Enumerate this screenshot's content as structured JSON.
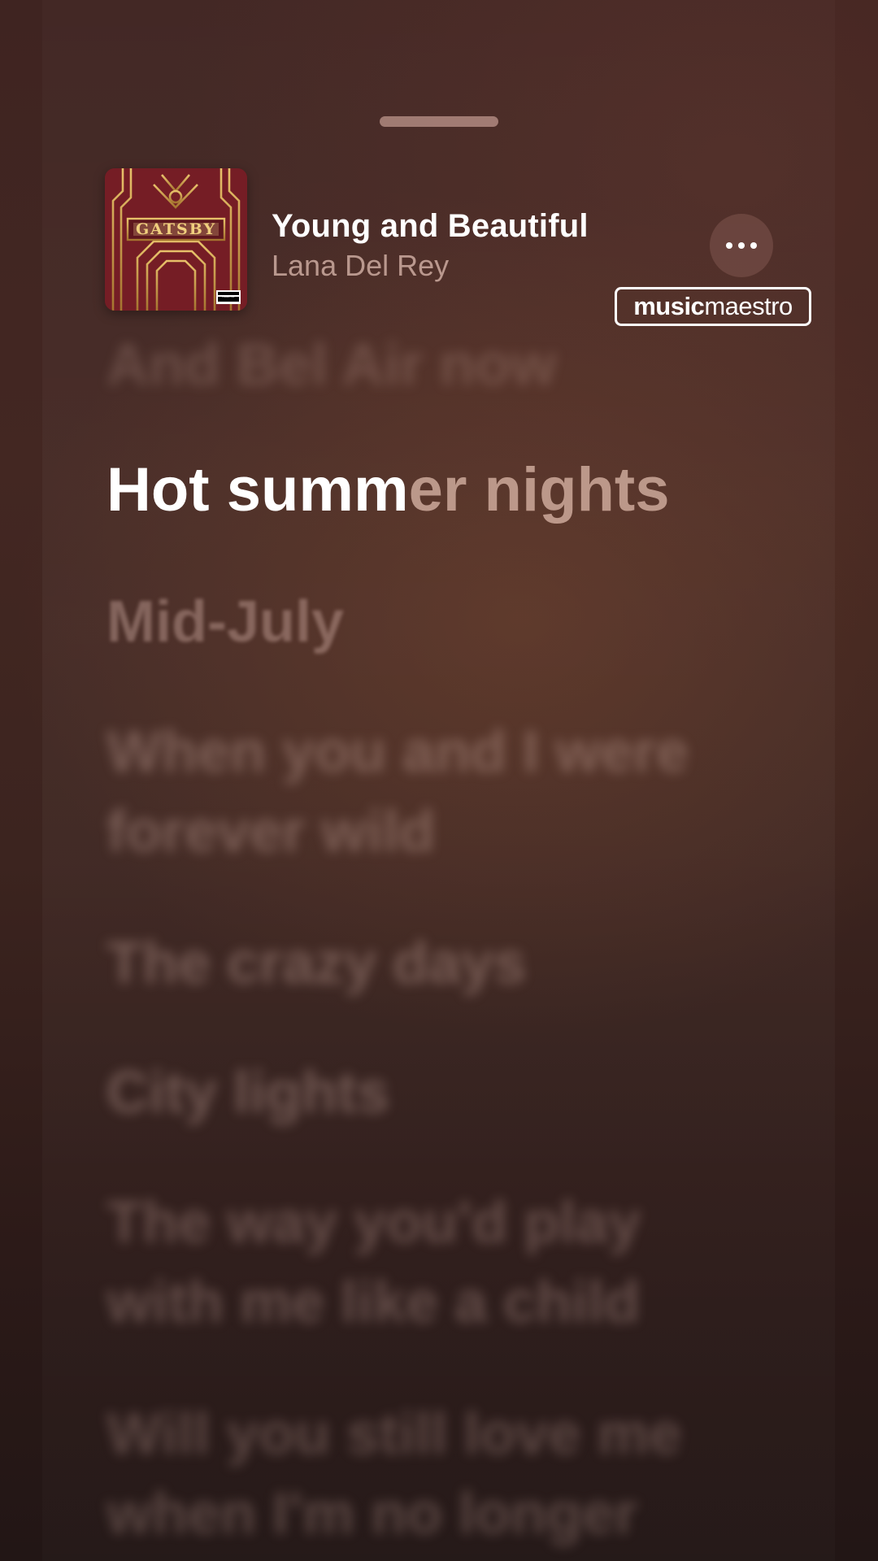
{
  "header": {
    "song_title": "Young and Beautiful",
    "artist": "Lana Del Rey",
    "more_label": "More options"
  },
  "album": {
    "art_text": "GATSBY",
    "advisory": "PARENTAL ADVISORY"
  },
  "watermark": {
    "bold": "music",
    "light": "maestro"
  },
  "lyrics": {
    "previous": "And Bel Air now",
    "current_sung": "Hot summ",
    "current_unsung": "er nights",
    "upcoming": [
      {
        "lines": [
          "Mid-July"
        ]
      },
      {
        "lines": [
          "When you and I were",
          "forever wild"
        ]
      },
      {
        "lines": [
          "The crazy days"
        ]
      },
      {
        "lines": [
          "City lights"
        ]
      },
      {
        "lines": [
          "The way you'd play",
          "with me like a child"
        ]
      },
      {
        "lines": [
          "Will you still love me",
          "when I'm no longer"
        ]
      }
    ]
  },
  "colors": {
    "background": "#3f2421",
    "active_lyric": "#ffffff",
    "inactive_lyric": "#cdaaa0"
  }
}
